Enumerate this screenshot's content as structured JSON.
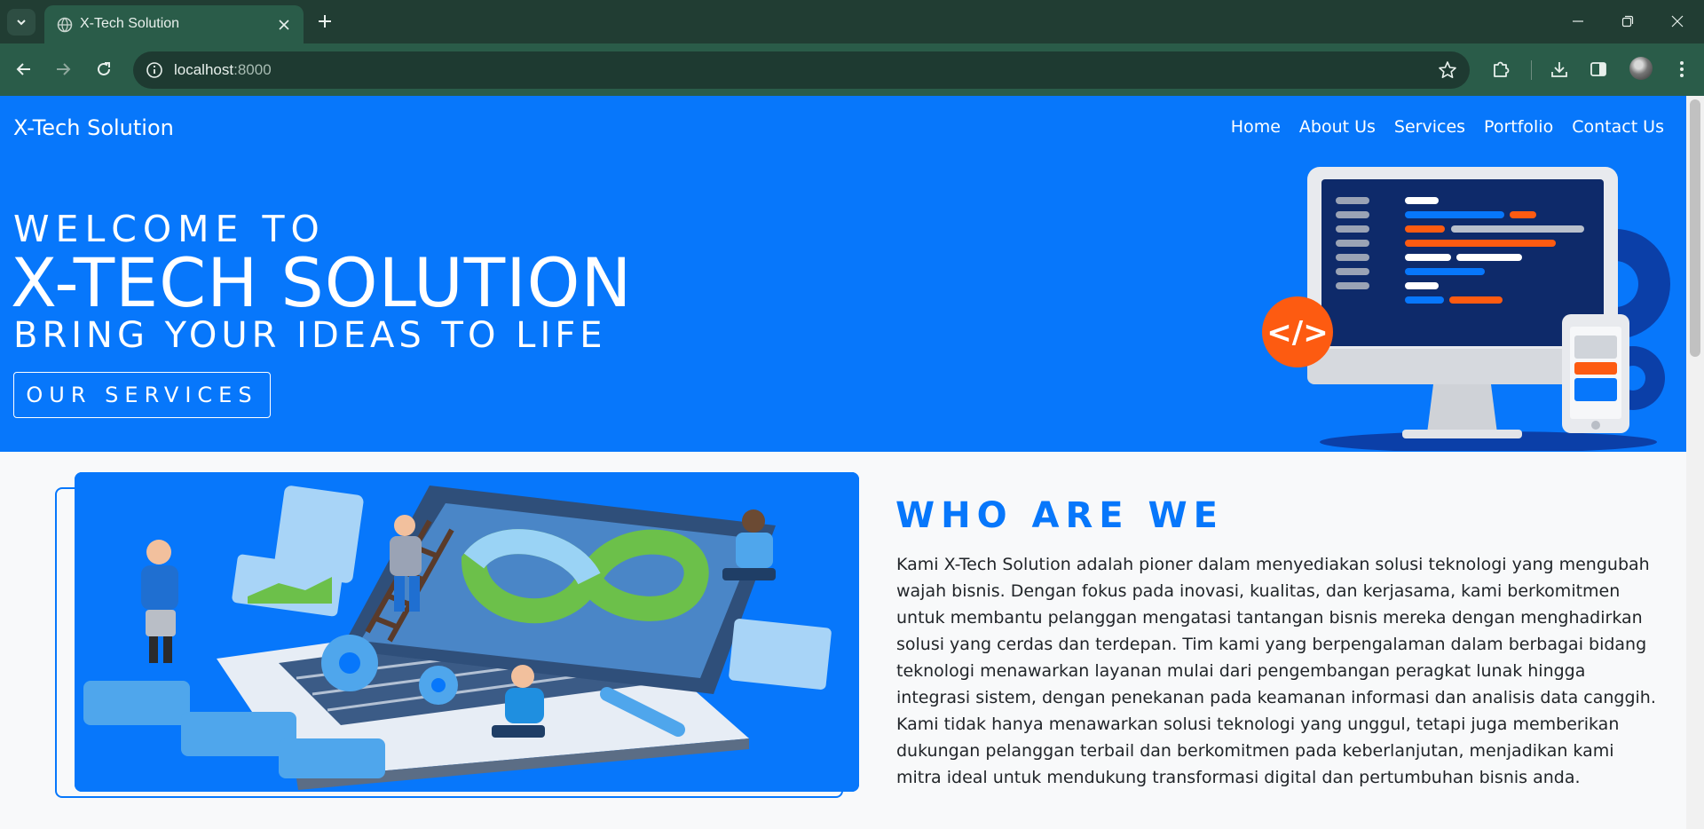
{
  "browser": {
    "tab_title": "X-Tech Solution",
    "url_host": "localhost",
    "url_port": ":8000"
  },
  "site": {
    "brand": "X-Tech Solution",
    "nav": [
      "Home",
      "About Us",
      "Services",
      "Portfolio",
      "Contact Us"
    ]
  },
  "hero": {
    "line1": "WELCOME TO",
    "line2": "X-TECH SOLUTION",
    "line3": "BRING YOUR IDEAS TO LIFE",
    "button": "OUR SERVICES",
    "code_badge": "</>"
  },
  "about": {
    "title": "WHO ARE WE",
    "text": "Kami X-Tech Solution adalah pioner dalam menyediakan solusi teknologi yang mengubah wajah bisnis. Dengan fokus pada inovasi, kualitas, dan kerjasama, kami berkomitmen untuk membantu pelanggan mengatasi tantangan bisnis mereka dengan menghadirkan solusi yang cerdas dan terdepan. Tim kami yang berpengalaman dalam berbagai bidang teknologi menawarkan layanan mulai dari pengembangan peragkat lunak hingga integrasi sistem, dengan penekanan pada keamanan informasi dan analisis data canggih. Kami tidak hanya menawarkan solusi teknologi yang unggul, tetapi juga memberikan dukungan pelanggan terbail dan berkomitmen pada keberlanjutan, menjadikan kami mitra ideal untuk mendukung transformasi digital dan pertumbuhan bisnis anda."
  },
  "colors": {
    "primary": "#0777fb",
    "accent": "#fd5b11",
    "chrome_dark": "#213d33",
    "chrome_toolbar": "#2a5c49"
  },
  "icons": [
    "tab-list-icon",
    "globe-icon",
    "close-icon",
    "plus-icon",
    "minimize-icon",
    "restore-icon",
    "back-icon",
    "forward-icon",
    "reload-icon",
    "info-icon",
    "star-icon",
    "extensions-icon",
    "download-icon",
    "sidebar-icon",
    "more-icon"
  ]
}
